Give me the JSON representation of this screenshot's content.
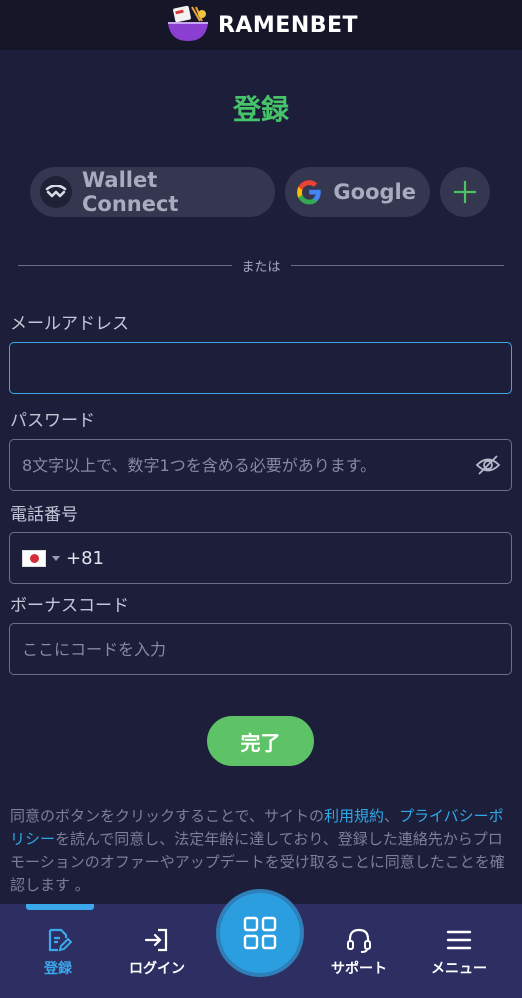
{
  "header": {
    "brand": "RAMENBET"
  },
  "page": {
    "title": "登録"
  },
  "social": {
    "wallet_label": "Wallet Connect",
    "google_label": "Google",
    "more_label": "+"
  },
  "divider": {
    "text": "または"
  },
  "form": {
    "email_label": "メールアドレス",
    "email_value": "",
    "password_label": "パスワード",
    "password_placeholder": "8文字以上で、数字1つを含める必要があります。",
    "phone_label": "電話番号",
    "phone_prefix": "+81",
    "bonus_label": "ボーナスコード",
    "bonus_placeholder": "ここにコードを入力",
    "submit_label": "完了"
  },
  "terms": {
    "part1": "同意のボタンをクリックすることで、サイトの",
    "link1": "利用規約",
    "sep": "、",
    "link2": "プライバシーポリシー",
    "part2": "を読んで同意し、法定年齢に達しており、登録した連絡先からプロモーションのオファーやアップデートを受け取ることに同意したことを確認します 。"
  },
  "nav": {
    "register": "登録",
    "login": "ログイン",
    "support": "サポート",
    "menu": "メニュー"
  },
  "colors": {
    "background": "#1d1f3a",
    "accent_green": "#45c46a",
    "accent_blue": "#3aa8ea",
    "nav_bg": "#2d2f63"
  }
}
